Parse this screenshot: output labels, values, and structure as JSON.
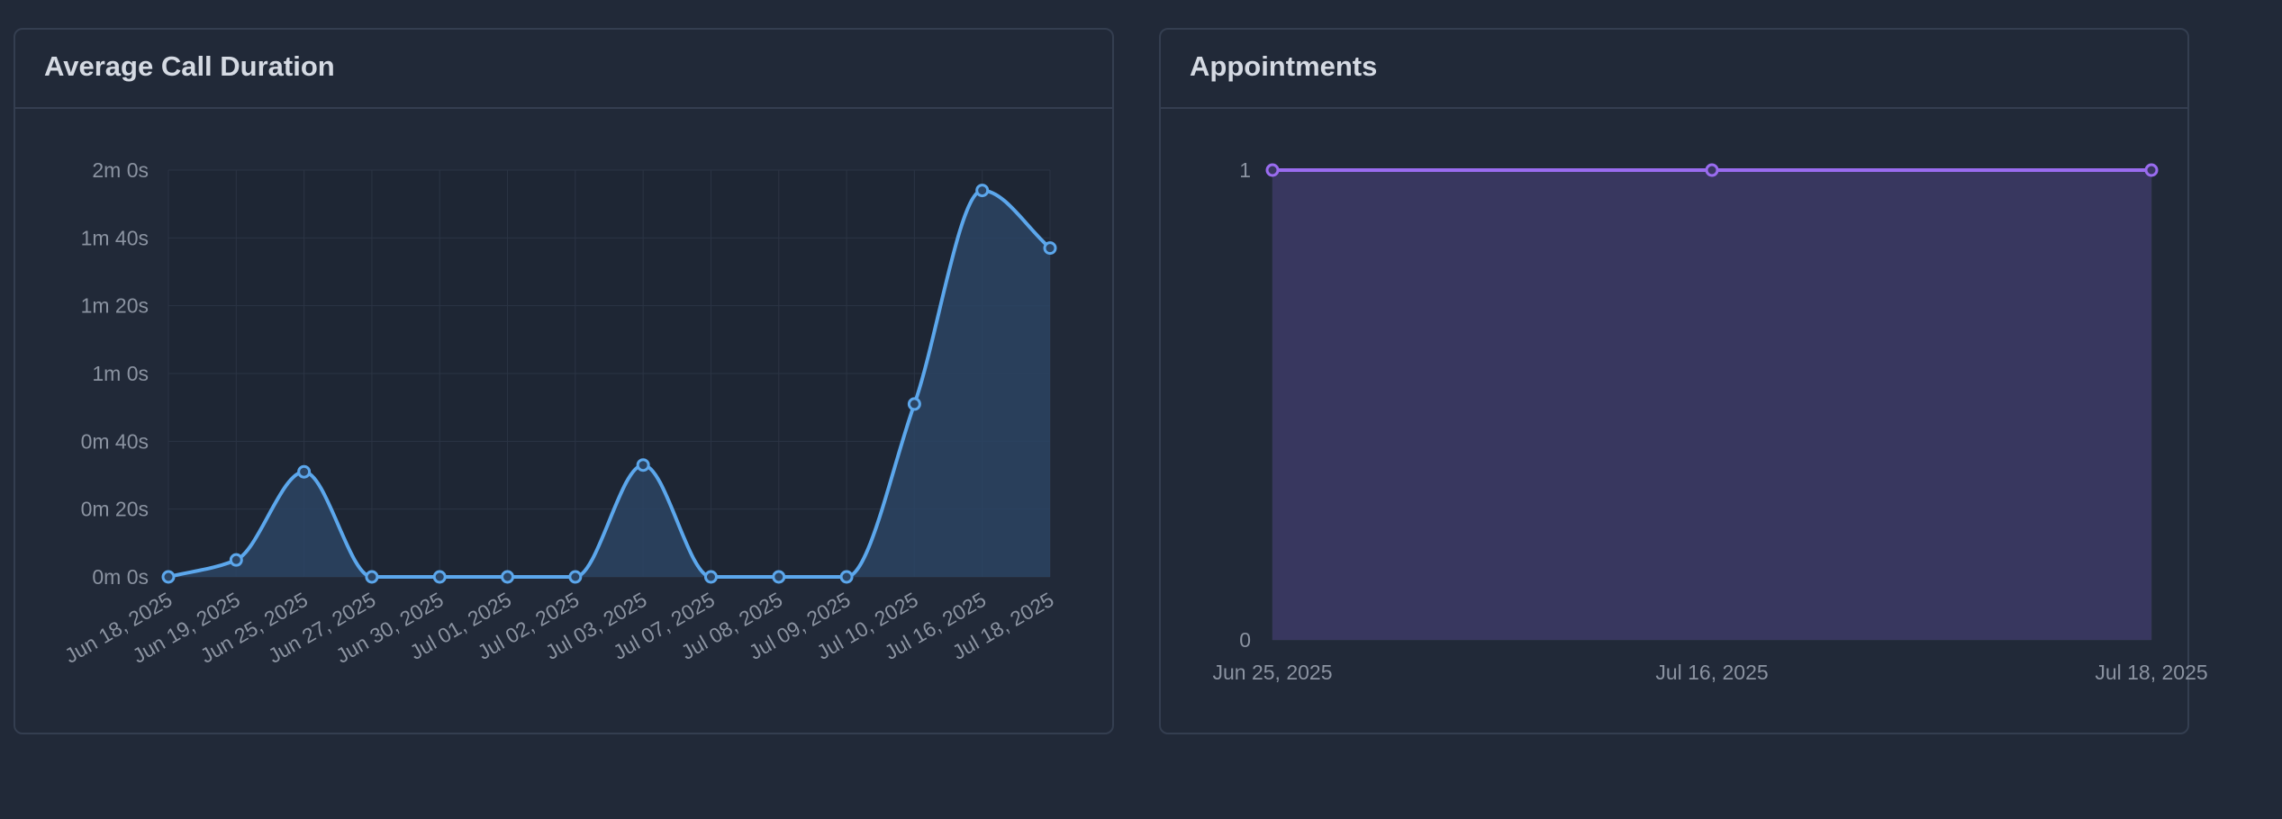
{
  "colors": {
    "background": "#212938",
    "card_border": "#343e50",
    "title": "#d5dae3",
    "tick_text": "#8b93a1",
    "duration_line": "#5ca7ec",
    "duration_fill": "#2b4463",
    "appointments_line": "#9a6cf0",
    "appointments_fill": "#38375f"
  },
  "cards": {
    "duration": {
      "title": "Average Call Duration"
    },
    "appointments": {
      "title": "Appointments"
    }
  },
  "chart_data": [
    {
      "type": "area",
      "title": "Average Call Duration",
      "x": [
        "Jun 18, 2025",
        "Jun 19, 2025",
        "Jun 25, 2025",
        "Jun 27, 2025",
        "Jun 30, 2025",
        "Jul 01, 2025",
        "Jul 02, 2025",
        "Jul 03, 2025",
        "Jul 07, 2025",
        "Jul 08, 2025",
        "Jul 09, 2025",
        "Jul 10, 2025",
        "Jul 16, 2025",
        "Jul 18, 2025"
      ],
      "values_seconds": [
        0,
        5,
        31,
        0,
        0,
        0,
        0,
        33,
        0,
        0,
        0,
        51,
        114,
        97
      ],
      "y_ticks": [
        "0m 0s",
        "0m 20s",
        "0m 40s",
        "1m 0s",
        "1m 20s",
        "1m 40s",
        "2m 0s"
      ],
      "ylim_seconds": [
        0,
        120
      ],
      "smooth": true,
      "grid": true
    },
    {
      "type": "area",
      "title": "Appointments",
      "x": [
        "Jun 25, 2025",
        "Jul 16, 2025",
        "Jul 18, 2025"
      ],
      "values": [
        1,
        1,
        1
      ],
      "y_ticks": [
        "0",
        "1"
      ],
      "ylim": [
        0,
        1
      ],
      "grid": true
    }
  ]
}
